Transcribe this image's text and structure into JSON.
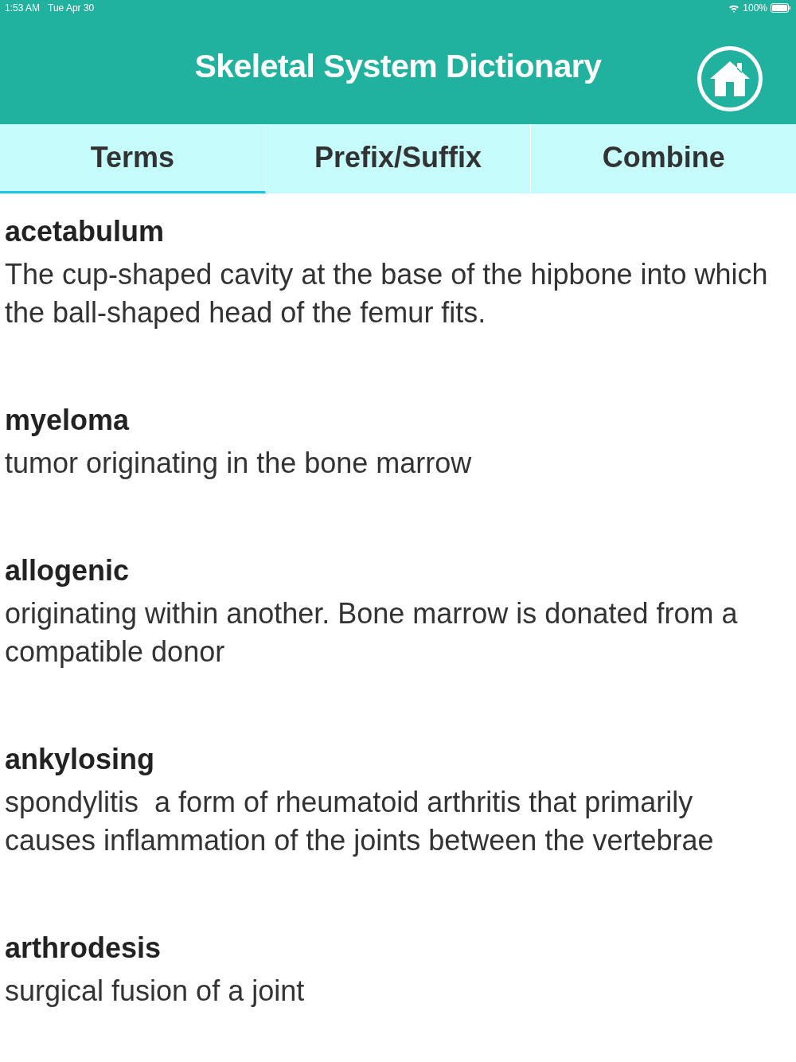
{
  "status_bar": {
    "time": "1:53 AM",
    "date": "Tue Apr 30",
    "battery": "100%"
  },
  "header": {
    "title": "Skeletal System Dictionary"
  },
  "tabs": [
    {
      "label": "Terms",
      "selected": true
    },
    {
      "label": "Prefix/Suffix",
      "selected": false
    },
    {
      "label": "Combine",
      "selected": false
    }
  ],
  "entries": [
    {
      "term": "acetabulum",
      "definition": "The cup-shaped cavity at the base of the hipbone into which the ball-shaped head of the femur fits."
    },
    {
      "term": "myeloma",
      "definition": "tumor originating in the bone marrow"
    },
    {
      "term": "allogenic",
      "definition": "originating within another. Bone marrow is donated from a compatible donor"
    },
    {
      "term": "ankylosing",
      "definition": "spondylitis  a form of rheumatoid arthritis that primarily causes inflammation of the joints between the vertebrae"
    },
    {
      "term": "arthrodesis",
      "definition": "surgical fusion of a joint"
    }
  ]
}
